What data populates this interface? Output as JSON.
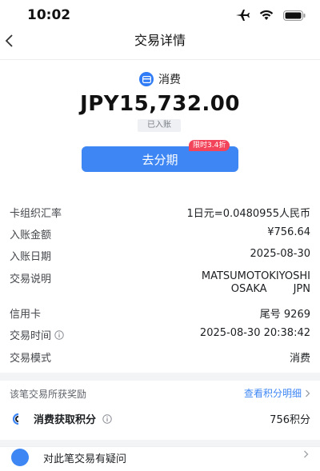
{
  "status_bar": {
    "time": "10:02",
    "icons": [
      "airplane-icon",
      "wifi-icon",
      "battery-icon"
    ]
  },
  "nav": {
    "title": "交易详情",
    "back_icon": "chevron-left-icon"
  },
  "summary": {
    "type_label": "消费",
    "type_icon": "card-icon",
    "amount": "JPY15,732.00",
    "status": "已入账",
    "installment_button": "去分期",
    "promo_tag": "限时3.4折"
  },
  "details": [
    {
      "label": "卡组织汇率",
      "value": "1日元=0.0480955人民币"
    },
    {
      "label": "入账金额",
      "value": "¥756.64"
    },
    {
      "label": "入账日期",
      "value": "2025-08-30"
    },
    {
      "label": "交易说明",
      "value": "MATSUMOTOKIYOSHI",
      "value2": "OSAKA        JPN"
    },
    {
      "label": "信用卡",
      "value": "尾号 9269"
    },
    {
      "label": "交易时间",
      "value": "2025-08-30 20:38:42"
    },
    {
      "label": "交易模式",
      "value": "消费"
    }
  ],
  "rewards": {
    "title": "该笔交易所获奖励",
    "link": "查看积分明细",
    "points_label": "消费获取积分",
    "points_value": "756积分"
  },
  "bottom": {
    "label": "对此笔交易有疑问"
  },
  "colors": {
    "accent": "#3d86f4",
    "promo": "#f2445a",
    "background": "#f3f4f6"
  }
}
